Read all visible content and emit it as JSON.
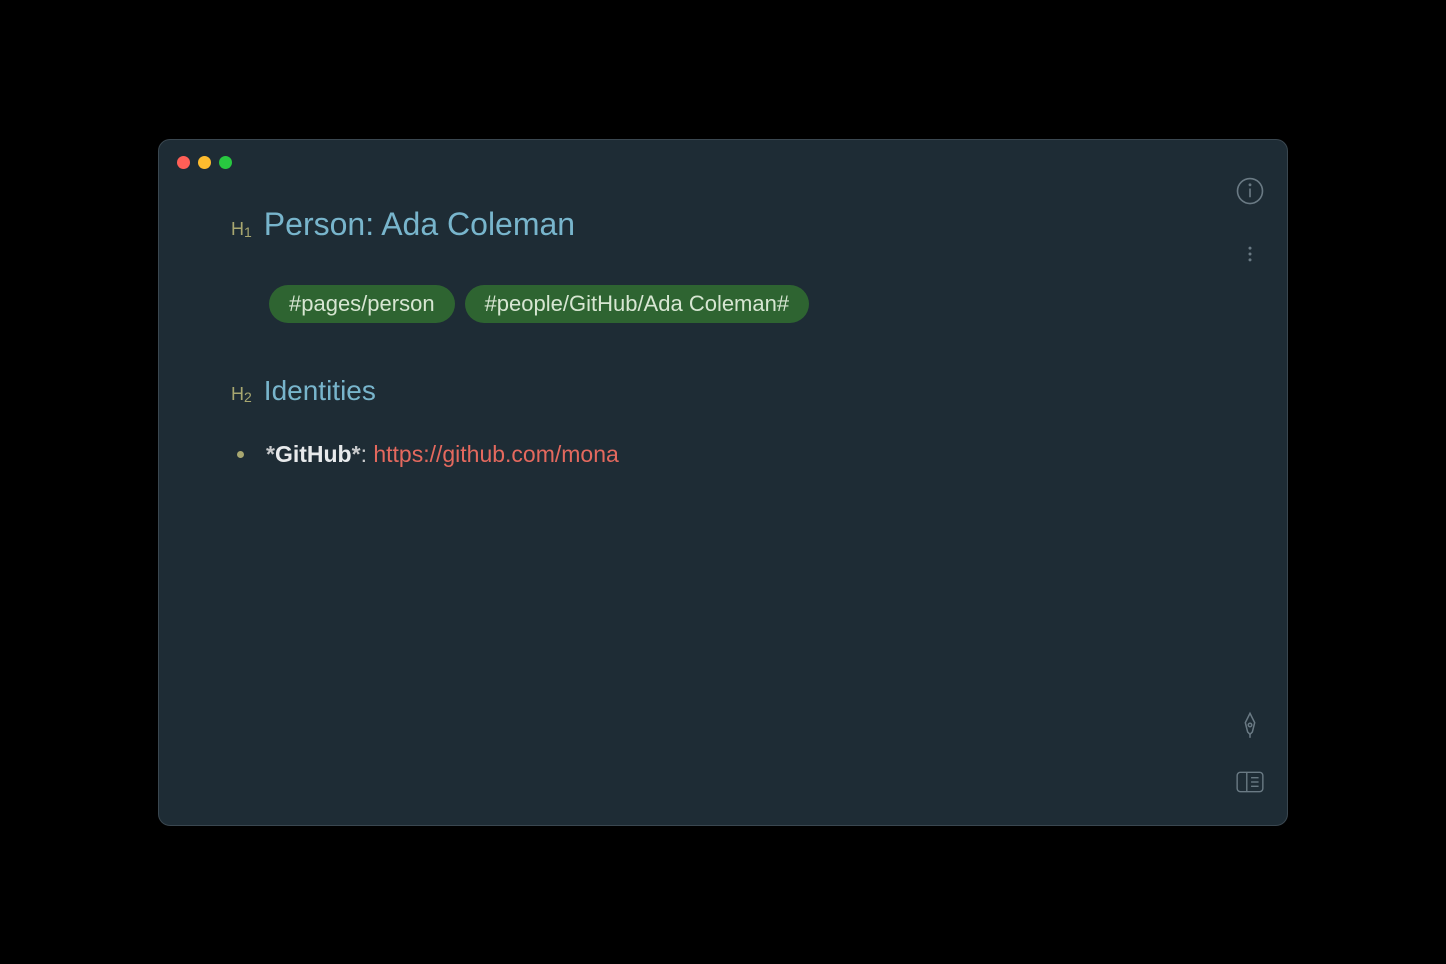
{
  "document": {
    "h1_marker": "H",
    "h1_marker_sub": "1",
    "h1_text": "Person: Ada Coleman",
    "tags": [
      "#pages/person",
      "#people/GitHub/Ada Coleman#"
    ],
    "h2_marker": "H",
    "h2_marker_sub": "2",
    "h2_text": "Identities",
    "bullet": {
      "prefix_asterisk": "*",
      "label": "GitHub",
      "suffix_asterisk": "*",
      "separator": ": ",
      "url": "https://github.com/mona"
    }
  },
  "icons": {
    "info": "info-icon",
    "more": "more-icon",
    "pen": "pen-icon",
    "book": "book-icon"
  }
}
